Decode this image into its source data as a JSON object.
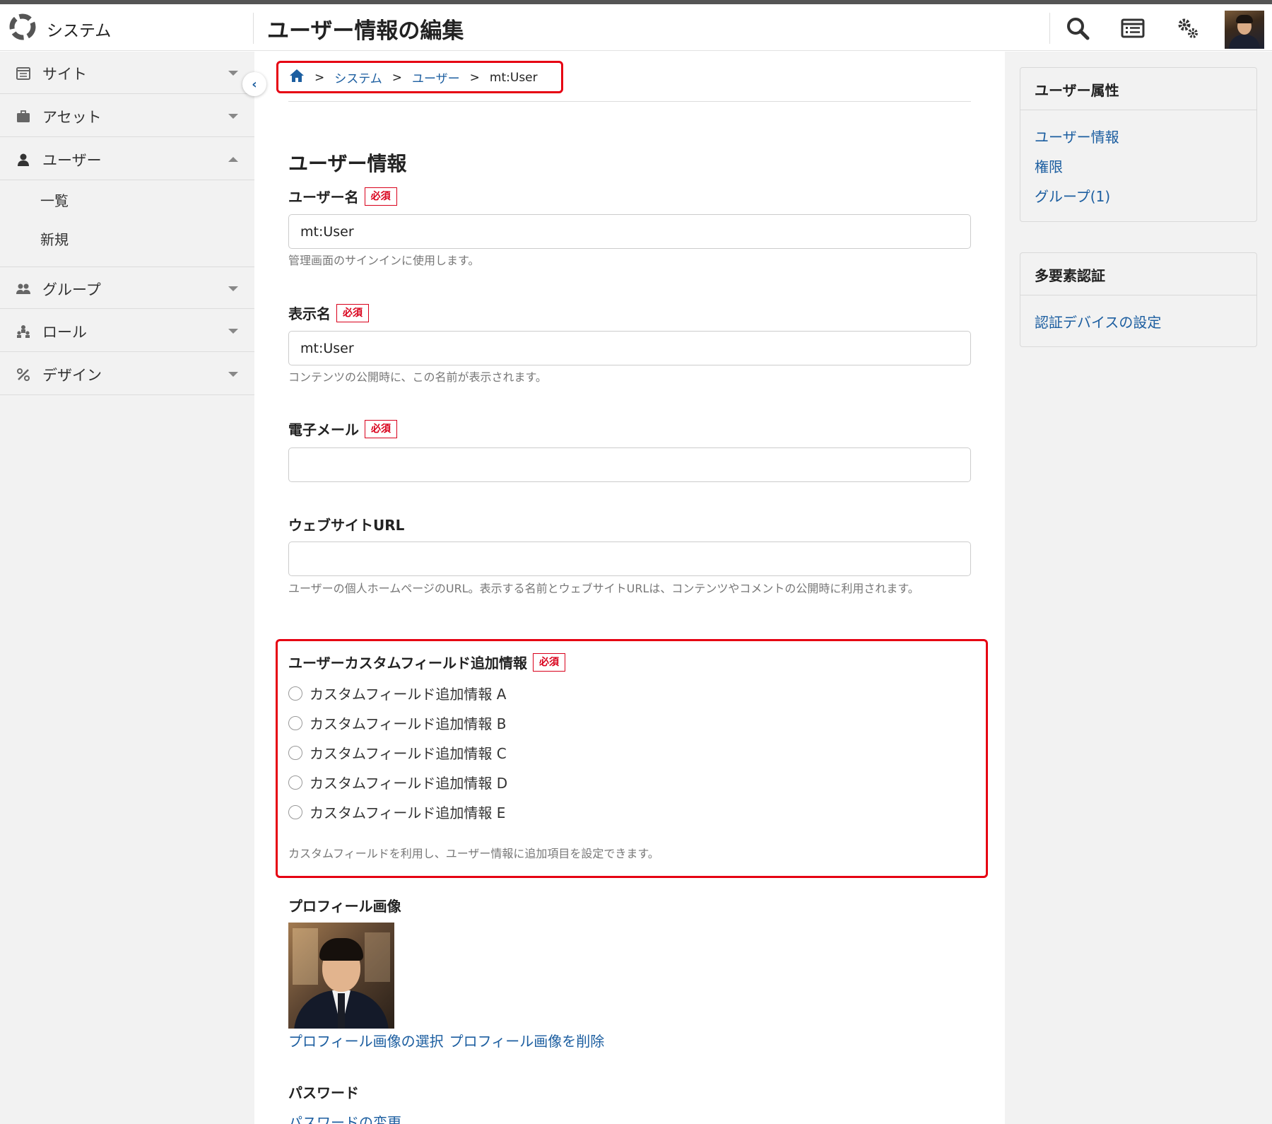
{
  "header": {
    "system_label": "システム",
    "page_title": "ユーザー情報の編集"
  },
  "sidebar": {
    "items": [
      {
        "label": "サイト",
        "icon": "list-icon",
        "expanded": false
      },
      {
        "label": "アセット",
        "icon": "briefcase-icon",
        "expanded": false
      },
      {
        "label": "ユーザー",
        "icon": "user-icon",
        "expanded": true
      },
      {
        "label": "グループ",
        "icon": "group-icon",
        "expanded": false
      },
      {
        "label": "ロール",
        "icon": "role-icon",
        "expanded": false
      },
      {
        "label": "デザイン",
        "icon": "design-icon",
        "expanded": false
      }
    ],
    "user_subitems": [
      "一覧",
      "新規"
    ]
  },
  "breadcrumb": {
    "items": [
      "システム",
      "ユーザー",
      "mt:User"
    ],
    "separator": ">"
  },
  "form": {
    "section_title": "ユーザー情報",
    "required_badge": "必須",
    "username": {
      "label": "ユーザー名",
      "value": "mt:User",
      "hint": "管理画面のサインインに使用します。"
    },
    "display_name": {
      "label": "表示名",
      "value": "mt:User",
      "hint": "コンテンツの公開時に、この名前が表示されます。"
    },
    "email": {
      "label": "電子メール",
      "value": ""
    },
    "website": {
      "label": "ウェブサイトURL",
      "value": "",
      "hint": "ユーザーの個人ホームページのURL。表示する名前とウェブサイトURLは、コンテンツやコメントの公開時に利用されます。"
    },
    "custom_field": {
      "label": "ユーザーカスタムフィールド追加情報",
      "options": [
        "カスタムフィールド追加情報 A",
        "カスタムフィールド追加情報 B",
        "カスタムフィールド追加情報 C",
        "カスタムフィールド追加情報 D",
        "カスタムフィールド追加情報 E"
      ],
      "hint": "カスタムフィールドを利用し、ユーザー情報に追加項目を設定できます。"
    },
    "profile_image": {
      "label": "プロフィール画像",
      "select_link": "プロフィール画像の選択",
      "delete_link": "プロフィール画像を削除"
    },
    "password": {
      "label": "パスワード",
      "change_link": "パスワードの変更"
    }
  },
  "right_panels": {
    "attributes": {
      "title": "ユーザー属性",
      "links": [
        "ユーザー情報",
        "権限",
        "グループ(1)"
      ]
    },
    "mfa": {
      "title": "多要素認証",
      "links": [
        "認証デバイスの設定"
      ]
    }
  },
  "colors": {
    "accent_link": "#1c5ea0",
    "required_red": "#d9001b",
    "highlight_red": "#e60012",
    "sidebar_bg": "#f2f2f2"
  }
}
